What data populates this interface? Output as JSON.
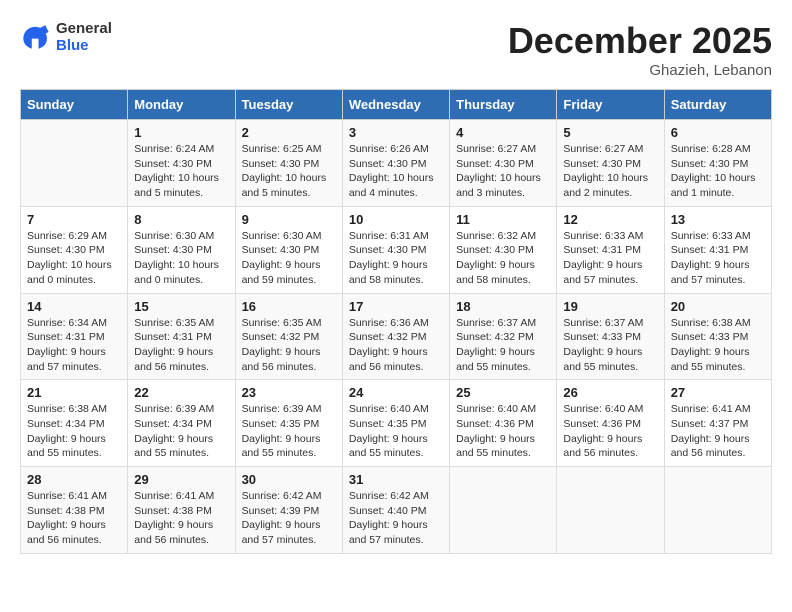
{
  "header": {
    "logo_general": "General",
    "logo_blue": "Blue",
    "month_title": "December 2025",
    "location": "Ghazieh, Lebanon"
  },
  "days_of_week": [
    "Sunday",
    "Monday",
    "Tuesday",
    "Wednesday",
    "Thursday",
    "Friday",
    "Saturday"
  ],
  "weeks": [
    [
      {
        "day": "",
        "info": ""
      },
      {
        "day": "1",
        "info": "Sunrise: 6:24 AM\nSunset: 4:30 PM\nDaylight: 10 hours\nand 5 minutes."
      },
      {
        "day": "2",
        "info": "Sunrise: 6:25 AM\nSunset: 4:30 PM\nDaylight: 10 hours\nand 5 minutes."
      },
      {
        "day": "3",
        "info": "Sunrise: 6:26 AM\nSunset: 4:30 PM\nDaylight: 10 hours\nand 4 minutes."
      },
      {
        "day": "4",
        "info": "Sunrise: 6:27 AM\nSunset: 4:30 PM\nDaylight: 10 hours\nand 3 minutes."
      },
      {
        "day": "5",
        "info": "Sunrise: 6:27 AM\nSunset: 4:30 PM\nDaylight: 10 hours\nand 2 minutes."
      },
      {
        "day": "6",
        "info": "Sunrise: 6:28 AM\nSunset: 4:30 PM\nDaylight: 10 hours\nand 1 minute."
      }
    ],
    [
      {
        "day": "7",
        "info": "Sunrise: 6:29 AM\nSunset: 4:30 PM\nDaylight: 10 hours\nand 0 minutes."
      },
      {
        "day": "8",
        "info": "Sunrise: 6:30 AM\nSunset: 4:30 PM\nDaylight: 10 hours\nand 0 minutes."
      },
      {
        "day": "9",
        "info": "Sunrise: 6:30 AM\nSunset: 4:30 PM\nDaylight: 9 hours\nand 59 minutes."
      },
      {
        "day": "10",
        "info": "Sunrise: 6:31 AM\nSunset: 4:30 PM\nDaylight: 9 hours\nand 58 minutes."
      },
      {
        "day": "11",
        "info": "Sunrise: 6:32 AM\nSunset: 4:30 PM\nDaylight: 9 hours\nand 58 minutes."
      },
      {
        "day": "12",
        "info": "Sunrise: 6:33 AM\nSunset: 4:31 PM\nDaylight: 9 hours\nand 57 minutes."
      },
      {
        "day": "13",
        "info": "Sunrise: 6:33 AM\nSunset: 4:31 PM\nDaylight: 9 hours\nand 57 minutes."
      }
    ],
    [
      {
        "day": "14",
        "info": "Sunrise: 6:34 AM\nSunset: 4:31 PM\nDaylight: 9 hours\nand 57 minutes."
      },
      {
        "day": "15",
        "info": "Sunrise: 6:35 AM\nSunset: 4:31 PM\nDaylight: 9 hours\nand 56 minutes."
      },
      {
        "day": "16",
        "info": "Sunrise: 6:35 AM\nSunset: 4:32 PM\nDaylight: 9 hours\nand 56 minutes."
      },
      {
        "day": "17",
        "info": "Sunrise: 6:36 AM\nSunset: 4:32 PM\nDaylight: 9 hours\nand 56 minutes."
      },
      {
        "day": "18",
        "info": "Sunrise: 6:37 AM\nSunset: 4:32 PM\nDaylight: 9 hours\nand 55 minutes."
      },
      {
        "day": "19",
        "info": "Sunrise: 6:37 AM\nSunset: 4:33 PM\nDaylight: 9 hours\nand 55 minutes."
      },
      {
        "day": "20",
        "info": "Sunrise: 6:38 AM\nSunset: 4:33 PM\nDaylight: 9 hours\nand 55 minutes."
      }
    ],
    [
      {
        "day": "21",
        "info": "Sunrise: 6:38 AM\nSunset: 4:34 PM\nDaylight: 9 hours\nand 55 minutes."
      },
      {
        "day": "22",
        "info": "Sunrise: 6:39 AM\nSunset: 4:34 PM\nDaylight: 9 hours\nand 55 minutes."
      },
      {
        "day": "23",
        "info": "Sunrise: 6:39 AM\nSunset: 4:35 PM\nDaylight: 9 hours\nand 55 minutes."
      },
      {
        "day": "24",
        "info": "Sunrise: 6:40 AM\nSunset: 4:35 PM\nDaylight: 9 hours\nand 55 minutes."
      },
      {
        "day": "25",
        "info": "Sunrise: 6:40 AM\nSunset: 4:36 PM\nDaylight: 9 hours\nand 55 minutes."
      },
      {
        "day": "26",
        "info": "Sunrise: 6:40 AM\nSunset: 4:36 PM\nDaylight: 9 hours\nand 56 minutes."
      },
      {
        "day": "27",
        "info": "Sunrise: 6:41 AM\nSunset: 4:37 PM\nDaylight: 9 hours\nand 56 minutes."
      }
    ],
    [
      {
        "day": "28",
        "info": "Sunrise: 6:41 AM\nSunset: 4:38 PM\nDaylight: 9 hours\nand 56 minutes."
      },
      {
        "day": "29",
        "info": "Sunrise: 6:41 AM\nSunset: 4:38 PM\nDaylight: 9 hours\nand 56 minutes."
      },
      {
        "day": "30",
        "info": "Sunrise: 6:42 AM\nSunset: 4:39 PM\nDaylight: 9 hours\nand 57 minutes."
      },
      {
        "day": "31",
        "info": "Sunrise: 6:42 AM\nSunset: 4:40 PM\nDaylight: 9 hours\nand 57 minutes."
      },
      {
        "day": "",
        "info": ""
      },
      {
        "day": "",
        "info": ""
      },
      {
        "day": "",
        "info": ""
      }
    ]
  ]
}
